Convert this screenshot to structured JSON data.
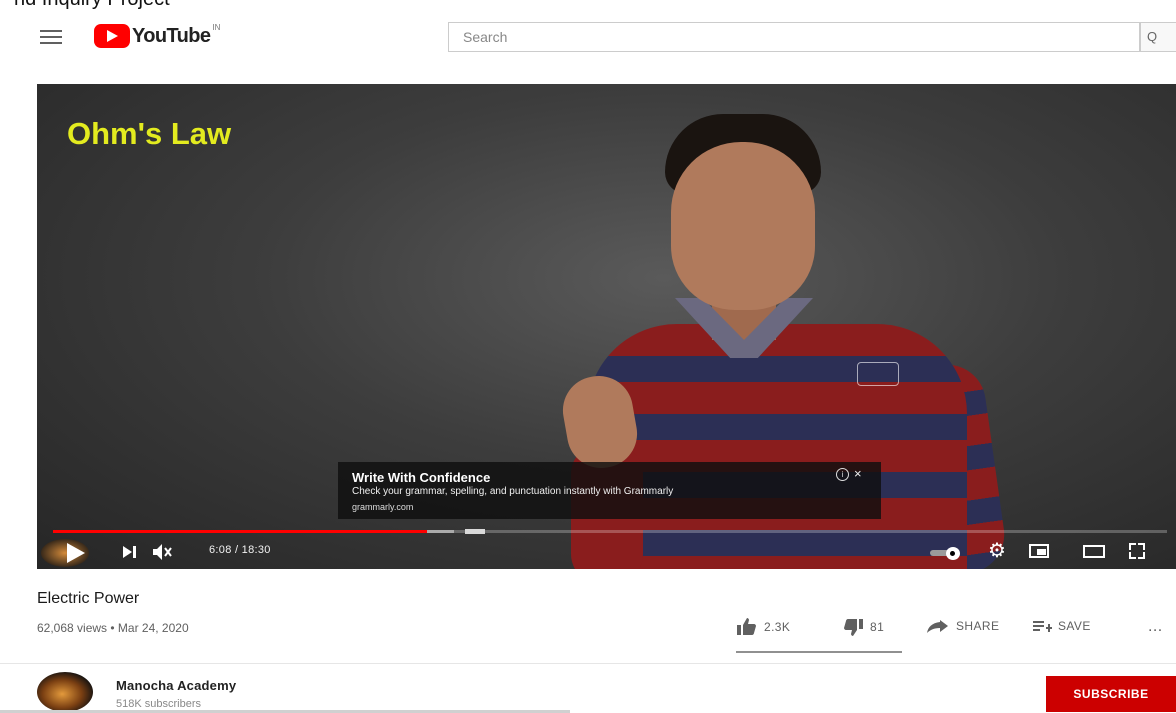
{
  "header": {
    "top_text": "nd Inquiry Project",
    "logo_text": "YouTube",
    "logo_sup": "IN",
    "search_placeholder": "Search",
    "search_button": "Q"
  },
  "player": {
    "video_overlay_title": "Ohm's Law",
    "ad": {
      "title": "Write With Confidence",
      "text": "Check your grammar, spelling, and punctuation instantly with Grammarly",
      "url": "grammarly.com",
      "info": "i",
      "close": "×"
    },
    "time": "6:08 / 18:30",
    "progress_played_fraction": 0.336,
    "progress_buffered_fraction": 0.36,
    "ad_marker_fraction": 0.37,
    "autoplay": true
  },
  "video": {
    "title": "Electric Power",
    "meta": "62,068 views • Mar 24, 2020",
    "likes": "2.3K",
    "dislikes": "81",
    "share_label": "SHARE",
    "save_label": "SAVE",
    "more_label": "..."
  },
  "channel": {
    "name": "Manocha Academy",
    "subscribers": "518K subscribers",
    "subscribe_label": "SUBSCRIBE"
  },
  "colors": {
    "brand_red": "#ff0000",
    "subscribe_red": "#cc0000",
    "overlay_title_yellow": "#e3eb1f"
  }
}
